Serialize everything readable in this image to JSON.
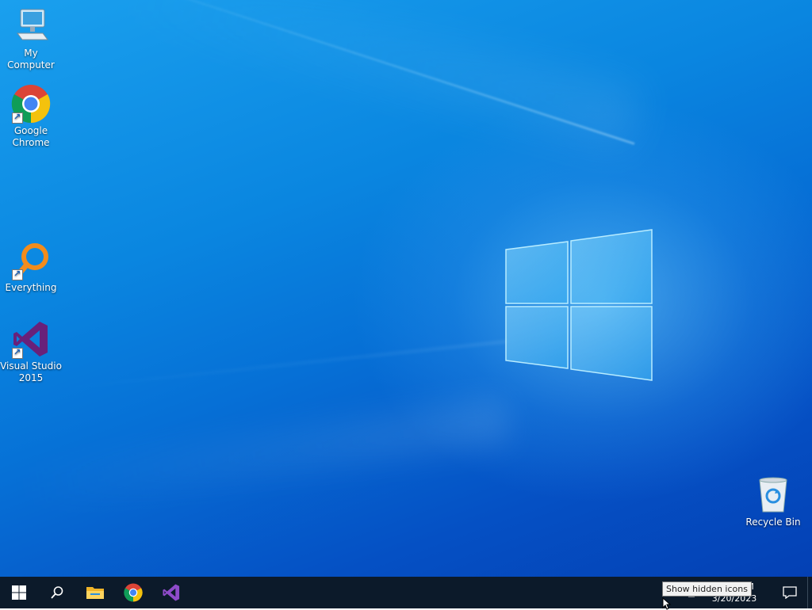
{
  "desktop": {
    "icons": [
      {
        "label": "My Computer"
      },
      {
        "label": "Google Chrome"
      },
      {
        "label": "Everything"
      },
      {
        "label": "Visual Studio 2015"
      },
      {
        "label": "Recycle Bin"
      }
    ]
  },
  "taskbar": {
    "pinned": [
      "start-icon",
      "search-icon",
      "file-explorer-icon",
      "chrome-icon",
      "visual-studio-icon"
    ],
    "clock": {
      "time": "M",
      "date": "3/20/2023"
    },
    "tooltip": "Show hidden icons"
  },
  "colors": {
    "taskbar": "#0c1a2a",
    "wallpaper_light": "#1aa0ee",
    "wallpaper_dark": "#0440b4",
    "vs_purple": "#68217a",
    "everything_orange": "#f28c1c"
  }
}
